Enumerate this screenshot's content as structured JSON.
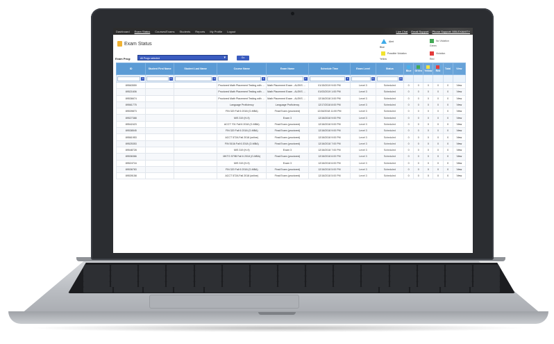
{
  "nav": {
    "items": [
      "Dashboard",
      "Exam Status",
      "Courses/Exams",
      "Students",
      "Reports",
      "My Profile",
      "Logout"
    ],
    "active": "Exam Status",
    "right": [
      "Live Chat",
      "Email Support",
      "Phone Support: 555-EXAMITY"
    ]
  },
  "page": {
    "title": "Exam Status",
    "exam_prog_label": "Exam Prog:",
    "exam_prog_value": "All Progs selected",
    "go_label": "Go"
  },
  "legend": [
    {
      "icon": "blue-triangle",
      "color": "#3aa9e8",
      "label": "Alert",
      "caption": "Blue"
    },
    {
      "icon": "green-flag",
      "color": "#2ea043",
      "label": "No Violation",
      "caption": "Green"
    },
    {
      "icon": "yellow-flag",
      "color": "#f2e22a",
      "label": "Possible Violation",
      "caption": "Yellow"
    },
    {
      "icon": "red-flag",
      "color": "#e02424",
      "label": "Violation",
      "caption": "Red"
    }
  ],
  "table": {
    "columns": [
      "ID",
      "Student First Name",
      "Student Last Name",
      "Course Name",
      "Exam Name",
      "Schedule Time",
      "Exam Level",
      "Status",
      "Blue",
      "Green",
      "Yellow",
      "Red",
      "Total",
      "View"
    ],
    "rows": [
      [
        "89563559",
        "",
        "",
        "Proctored Math Placement Testing with Examity",
        "Math Placement Exam - ALEKS PPL",
        "01/15/2019 9:00 PM",
        "Level 3",
        "Scheduled",
        "0",
        "0",
        "0",
        "0",
        "0",
        "View"
      ],
      [
        "89521606",
        "",
        "",
        "Proctored Math Placement Testing with Examity",
        "Math Placement Exam - ALEKS PPL",
        "01/03/2019 1:00 PM",
        "Level 3",
        "Scheduled",
        "0",
        "0",
        "0",
        "0",
        "0",
        "View"
      ],
      [
        "89536674",
        "",
        "",
        "Proctored Math Placement Testing with Examity",
        "Math Placement Exam - ALEKS PPL",
        "12/16/2018 3:00 PM",
        "Level 3",
        "Scheduled",
        "0",
        "0",
        "0",
        "0",
        "0",
        "View"
      ],
      [
        "89561775",
        "",
        "",
        "Language Proficiency",
        "Language Proficiency",
        "12/17/2018 8:00 PM",
        "Level 3",
        "Scheduled",
        "0",
        "0",
        "0",
        "0",
        "0",
        "View"
      ],
      [
        "89539873",
        "",
        "",
        "FIN 320 Fall 6 2018 (O-MBA)",
        "Final Exam (proctored)",
        "12/16/2018 11:00 PM",
        "Level 3",
        "Scheduled",
        "0",
        "0",
        "0",
        "0",
        "0",
        "View"
      ],
      [
        "89527388",
        "",
        "",
        "MIS 319 (H-9)",
        "Exam 3",
        "12/16/2018 9:00 PM",
        "Level 3",
        "Scheduled",
        "0",
        "0",
        "0",
        "0",
        "0",
        "View"
      ],
      [
        "89542423",
        "",
        "",
        "ACCT 701 Fall 6 2018 (O-MBA)",
        "Final Exam (proctored)",
        "12/16/2018 9:00 PM",
        "Level 3",
        "Scheduled",
        "0",
        "0",
        "0",
        "0",
        "0",
        "View"
      ],
      [
        "89538545",
        "",
        "",
        "FIN 320 Fall 6 2018 (O-MBA)",
        "Final Exam (proctored)",
        "12/16/2018 9:00 PM",
        "Level 3",
        "Scheduled",
        "0",
        "0",
        "0",
        "0",
        "0",
        "View"
      ],
      [
        "89561953",
        "",
        "",
        "ACCT 572A Fall 2018 (online)",
        "Final Exam (proctored)",
        "12/16/2018 9:00 PM",
        "Level 3",
        "Scheduled",
        "0",
        "0",
        "0",
        "0",
        "0",
        "View"
      ],
      [
        "89525353",
        "",
        "",
        "FIN 510A Fall 6 2018 (O-MBA)",
        "Final Exam (proctored)",
        "12/16/2018 7:00 PM",
        "Level 3",
        "Scheduled",
        "0",
        "0",
        "0",
        "0",
        "0",
        "View"
      ],
      [
        "89548728",
        "",
        "",
        "MIS 319 (H-9)",
        "Exam 3",
        "12/16/2018 7:00 PM",
        "Level 3",
        "Scheduled",
        "0",
        "0",
        "0",
        "0",
        "0",
        "View"
      ],
      [
        "89536366",
        "",
        "",
        "MKTG 579B Fall 6 2018 (O-MBA)",
        "Final Exam (proctored)",
        "12/16/2018 6:00 PM",
        "Level 3",
        "Scheduled",
        "0",
        "0",
        "0",
        "0",
        "0",
        "View"
      ],
      [
        "89524716",
        "",
        "",
        "MIS 319 (H-9)",
        "Exam 3",
        "12/16/2018 6:00 PM",
        "Level 3",
        "Scheduled",
        "0",
        "0",
        "0",
        "0",
        "0",
        "View"
      ],
      [
        "89536783",
        "",
        "",
        "FIN 320 Fall 6 2018 (O-MBA)",
        "Final Exam (proctored)",
        "12/16/2018 5:00 PM",
        "Level 3",
        "Scheduled",
        "0",
        "0",
        "0",
        "0",
        "0",
        "View"
      ],
      [
        "89539158",
        "",
        "",
        "ACCT 572A Fall 2018 (online)",
        "Final Exam (proctored)",
        "12/16/2018 5:00 PM",
        "Level 3",
        "Scheduled",
        "0",
        "0",
        "0",
        "0",
        "0",
        "View"
      ]
    ]
  }
}
